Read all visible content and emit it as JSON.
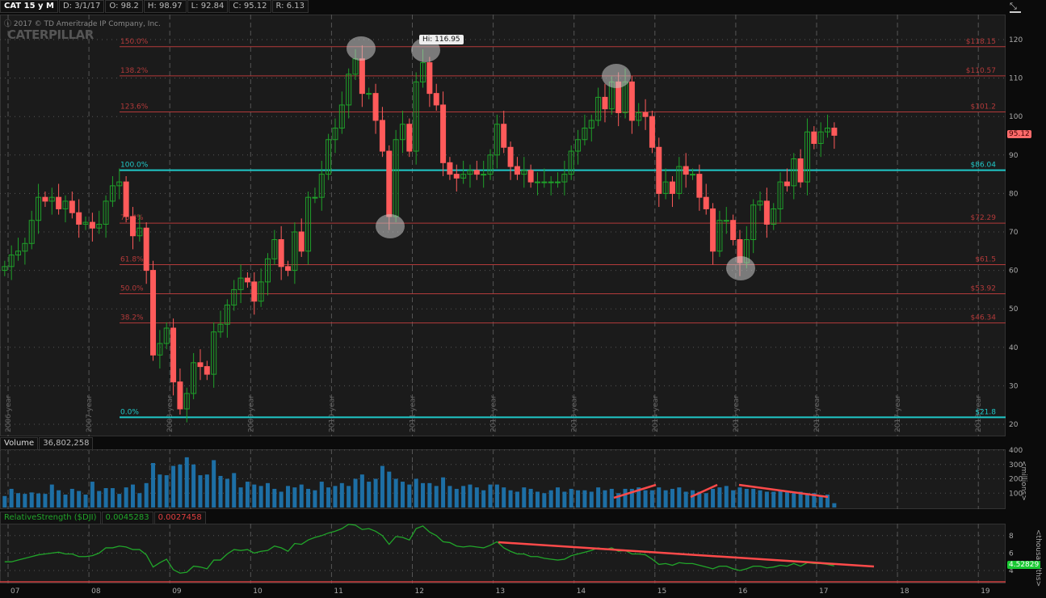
{
  "header": {
    "symbol": "CAT 15 y M",
    "date": "D: 3/1/17",
    "open": "O: 98.2",
    "high": "H: 98.97",
    "low": "L: 92.84",
    "close": "C: 95.12",
    "range": "R: 6.13"
  },
  "copyright": "2017 © TD Ameritrade IP Company, Inc.",
  "logo": "CATERPILLAR",
  "last_price_label": "95.12",
  "hi_callout": "Hi: 116.95",
  "colors": {
    "up": "#1fa02a",
    "down": "#ff5a5a",
    "fib": "#b33a3a",
    "fib_key": "#20c8c8",
    "volume": "#1d6fa5",
    "rs": "#21a52a"
  },
  "chart_data": {
    "type": "candlestick",
    "start_month": "2006-12",
    "closes": [
      61,
      64,
      65,
      67,
      73,
      79,
      78,
      79,
      76,
      78,
      75,
      72,
      72.5,
      71,
      72,
      78,
      82,
      83,
      74,
      69,
      71,
      60,
      38,
      41,
      45,
      31,
      24,
      28,
      36,
      35,
      33,
      44,
      46,
      51,
      55,
      58,
      57,
      52,
      57,
      63,
      68,
      61,
      60,
      70,
      65,
      79,
      79,
      85,
      94,
      97,
      103,
      111,
      115,
      106,
      106,
      99,
      91,
      74,
      94,
      98,
      91,
      109,
      114,
      106,
      103,
      88,
      85,
      84,
      85,
      86,
      85,
      85,
      90,
      98,
      92,
      87,
      85,
      86,
      83,
      83,
      83,
      83,
      83,
      85,
      91,
      94,
      97,
      99,
      105,
      102,
      109,
      101,
      109,
      99,
      101,
      100,
      92,
      80,
      83,
      80,
      87,
      85,
      85,
      79,
      76,
      65,
      73,
      73,
      68,
      62,
      68,
      77,
      78,
      72,
      76,
      83,
      82,
      89,
      83,
      96,
      93,
      96,
      97,
      95.12
    ],
    "yticks": [
      20,
      30,
      40,
      50,
      60,
      70,
      80,
      90,
      100,
      110,
      120
    ],
    "ylim": [
      20,
      125
    ],
    "xtick_labels": [
      "07",
      "08",
      "09",
      "10",
      "11",
      "12",
      "13",
      "14",
      "15",
      "16",
      "17",
      "18",
      "19"
    ],
    "year_labels": [
      "2006 year",
      "2007 year",
      "2008 year",
      "2009 year",
      "2010 year",
      "2011 year",
      "2012 year",
      "2013 year",
      "2014 year",
      "2015 year",
      "2016 year",
      "2017 year",
      "2018 year"
    ],
    "fib_levels": [
      {
        "pct": "150.0%",
        "price": 118.15,
        "label": "$118.15"
      },
      {
        "pct": "138.2%",
        "price": 110.57,
        "label": "$110.57"
      },
      {
        "pct": "123.6%",
        "price": 101.2,
        "label": "$101.2"
      },
      {
        "pct": "100.0%",
        "price": 86.04,
        "label": "$86.04",
        "key": true
      },
      {
        "pct": "76.4%",
        "price": 72.29,
        "label": "$72.29"
      },
      {
        "pct": "61.8%",
        "price": 61.5,
        "label": "$61.5"
      },
      {
        "pct": "50.0%",
        "price": 53.92,
        "label": "$53.92"
      },
      {
        "pct": "38.2%",
        "price": 46.34,
        "label": "$46.34"
      },
      {
        "pct": "0.0%",
        "price": 21.8,
        "label": "$21.8",
        "key": true
      }
    ]
  },
  "volume": {
    "title": "Volume",
    "value": "36,802,258",
    "unit": "<millions>",
    "yticks": [
      100,
      200,
      300,
      400
    ],
    "values": [
      80,
      130,
      100,
      95,
      105,
      98,
      95,
      160,
      120,
      90,
      130,
      115,
      90,
      180,
      115,
      135,
      135,
      95,
      140,
      160,
      100,
      170,
      310,
      230,
      225,
      290,
      300,
      350,
      300,
      225,
      230,
      330,
      220,
      200,
      240,
      140,
      180,
      160,
      150,
      170,
      130,
      110,
      150,
      140,
      160,
      130,
      120,
      180,
      140,
      150,
      170,
      150,
      200,
      230,
      180,
      200,
      290,
      250,
      200,
      180,
      160,
      200,
      170,
      170,
      150,
      210,
      150,
      130,
      150,
      160,
      140,
      120,
      160,
      160,
      140,
      120,
      110,
      140,
      130,
      110,
      100,
      120,
      140,
      110,
      130,
      120,
      120,
      110,
      140,
      120,
      130,
      100,
      130,
      130,
      140,
      120,
      120,
      140,
      120,
      130,
      140,
      110,
      120,
      110,
      100,
      130,
      140,
      150,
      120,
      140,
      130,
      130,
      120,
      110,
      110,
      120,
      110,
      100,
      110,
      100,
      100,
      80,
      90,
      30
    ]
  },
  "rs": {
    "title": "RelativeStrength ($DJI)",
    "value": "0.0045283",
    "value2": "0.0027458",
    "unit": "<thousandths>",
    "last": "4.52829",
    "yticks": [
      4,
      6,
      8
    ],
    "values": [
      5.0,
      5.0,
      5.2,
      5.4,
      5.6,
      5.8,
      5.9,
      6.0,
      6.1,
      5.9,
      5.9,
      5.6,
      5.6,
      5.7,
      6.0,
      6.6,
      6.6,
      6.8,
      6.7,
      6.4,
      6.4,
      5.8,
      4.4,
      4.9,
      5.3,
      4.1,
      3.7,
      3.8,
      4.5,
      4.4,
      4.2,
      5.2,
      5.2,
      5.9,
      6.4,
      6.3,
      6.4,
      6.0,
      6.2,
      6.3,
      6.8,
      6.6,
      6.2,
      7.1,
      7.0,
      7.5,
      7.8,
      8.0,
      8.3,
      8.5,
      8.8,
      9.3,
      9.2,
      8.7,
      8.8,
      8.5,
      8.0,
      7.0,
      7.9,
      7.8,
      7.5,
      8.8,
      9.1,
      8.4,
      8.0,
      7.3,
      7.2,
      6.8,
      6.7,
      6.8,
      6.7,
      6.6,
      6.9,
      7.3,
      6.6,
      6.2,
      5.9,
      5.9,
      5.6,
      5.6,
      5.4,
      5.3,
      5.2,
      5.3,
      5.7,
      5.9,
      6.1,
      6.3,
      6.6,
      6.4,
      6.6,
      6.2,
      6.3,
      5.9,
      5.9,
      5.8,
      5.3,
      4.7,
      4.8,
      4.6,
      4.9,
      4.8,
      4.8,
      4.6,
      4.4,
      4.2,
      4.5,
      4.5,
      4.2,
      4.0,
      4.2,
      4.5,
      4.5,
      4.3,
      4.4,
      4.6,
      4.5,
      4.8,
      4.5,
      4.9,
      4.8,
      4.8,
      4.7,
      4.53
    ]
  }
}
